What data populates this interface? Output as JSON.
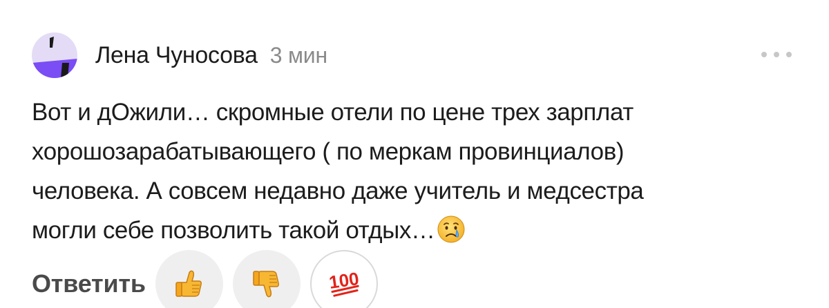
{
  "comment": {
    "author": "Лена Чуносова",
    "time": "3 мин",
    "text_lines": [
      "Вот и дОжили… скромные отели по цене трех зарплат",
      "хорошозарабатывающего ( по меркам провинциалов)",
      "человека. А совсем недавно даже учитель и медсестра",
      "могли себе позволить такой отдых…"
    ],
    "trailing_emoji": "crying-face-icon"
  },
  "actions": {
    "reply_label": "Ответить",
    "reactions": [
      {
        "icon": "thumbs-up-icon"
      },
      {
        "icon": "thumbs-down-icon"
      },
      {
        "icon": "hundred-points-icon",
        "label": "100"
      }
    ]
  },
  "colors": {
    "author": "#1b1b1b",
    "time": "#8a8a8a",
    "reply": "#4a4a4a",
    "reaction_bg": "#efefef",
    "avatar_bg": "#e2d9f5",
    "avatar_accent": "#7a4df5"
  }
}
